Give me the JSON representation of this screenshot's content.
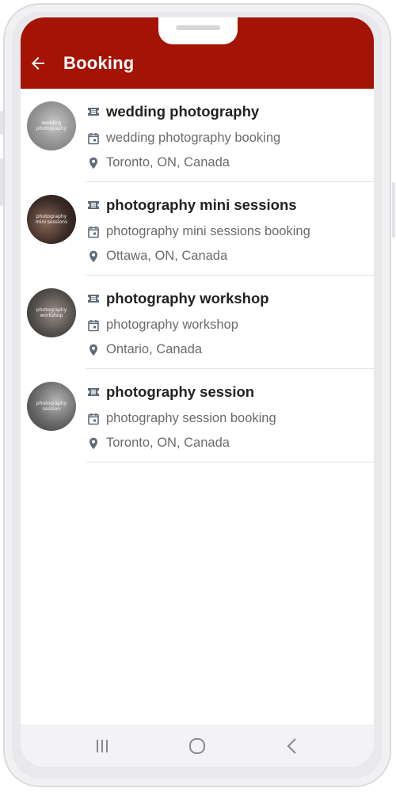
{
  "header": {
    "title": "Booking",
    "back_icon": "arrow-left-icon",
    "color": "#a41405"
  },
  "items": [
    {
      "name": "wedding photography",
      "description": "wedding photography booking",
      "location": "Toronto, ON, Canada",
      "thumb_text": "wedding photography"
    },
    {
      "name": "photography mini sessions",
      "description": "photography mini sessions booking",
      "location": "Ottawa, ON, Canada",
      "thumb_text": "photography mini sessions"
    },
    {
      "name": "photography workshop",
      "description": "photography workshop",
      "location": "Ontario, Canada",
      "thumb_text": "photography workshop"
    },
    {
      "name": "photography session",
      "description": "photography session booking",
      "location": "Toronto, ON, Canada",
      "thumb_text": "photography session"
    }
  ],
  "icons": {
    "name": "ticket-icon",
    "description": "calendar-icon",
    "location": "map-pin-icon"
  },
  "navbar": {
    "recents": "recents-icon",
    "home": "home-icon",
    "back": "back-chevron-icon"
  }
}
